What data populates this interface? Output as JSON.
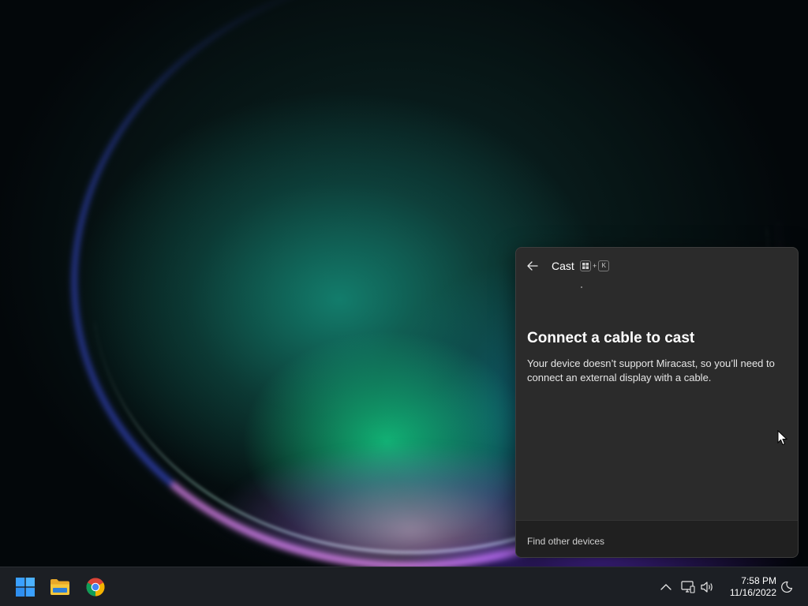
{
  "desktop": {
    "wallpaper": "windows-11-bloom-dark"
  },
  "cast_panel": {
    "title": "Cast",
    "shortcut_keys": [
      "win-key-icon",
      "K"
    ],
    "shortcut_plus": "+",
    "heading": "Connect a cable to cast",
    "description": "Your device doesn’t support Miracast, so you’ll need to connect an external display with a cable.",
    "footer_link": "Find other devices",
    "colors": {
      "panel_bg": "#2b2b2b",
      "footer_bg": "#202020"
    }
  },
  "taskbar": {
    "pinned": [
      {
        "name": "start-button",
        "icon": "windows-logo-icon"
      },
      {
        "name": "file-explorer-button",
        "icon": "folder-icon"
      },
      {
        "name": "chrome-button",
        "icon": "chrome-icon"
      }
    ],
    "tray": {
      "icons": [
        "chevron-up-icon",
        "network-icon",
        "volume-icon",
        "focus-moon-icon"
      ],
      "time": "7:58 PM",
      "date": "11/16/2022"
    },
    "colors": {
      "windows_blue": "#3aa0ff",
      "folder_yellow": "#f5c63b"
    }
  }
}
